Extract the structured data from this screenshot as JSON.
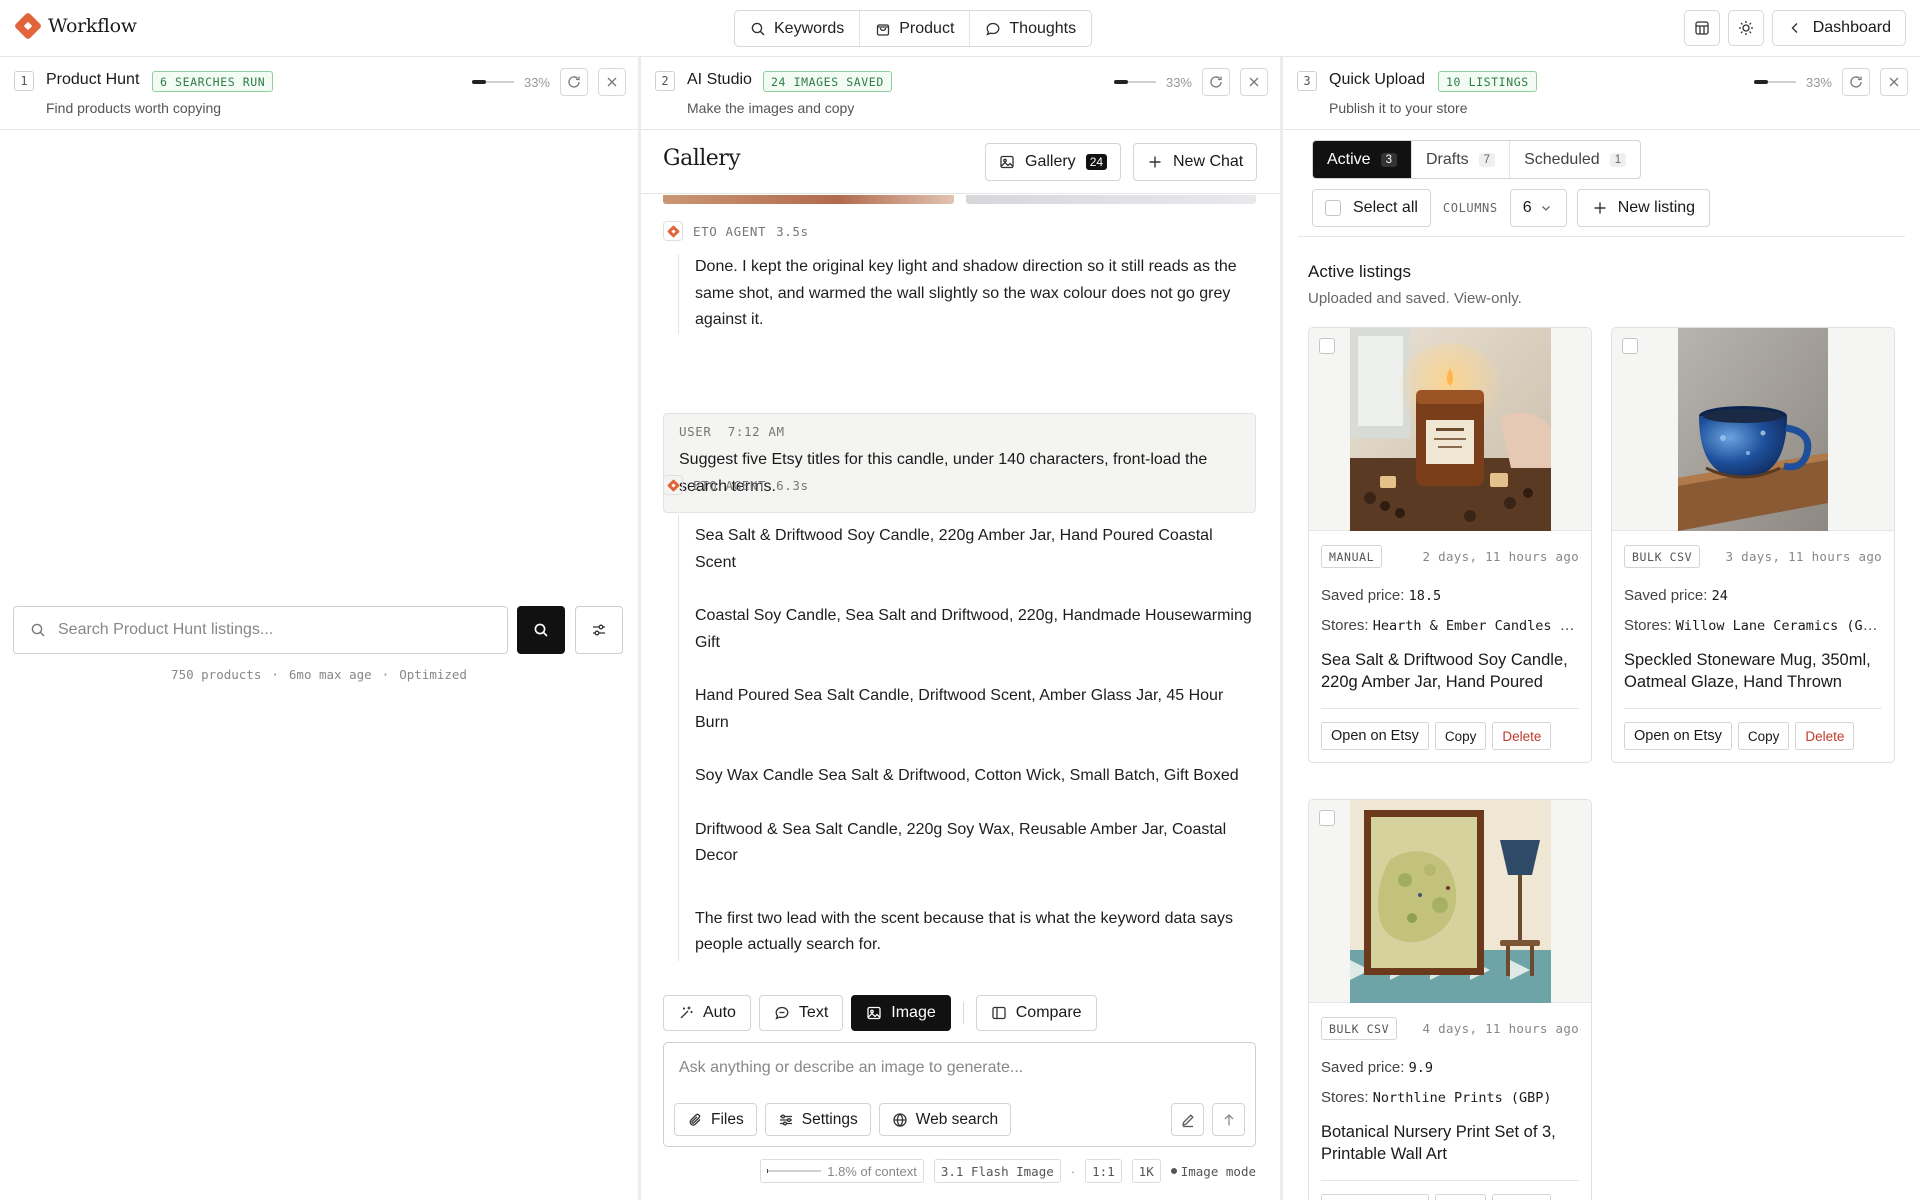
{
  "app": {
    "name": "Workflow"
  },
  "nav": {
    "keywords": "Keywords",
    "product": "Product",
    "thoughts": "Thoughts",
    "dashboard": "Dashboard"
  },
  "col1": {
    "index": "1",
    "title": "Product Hunt",
    "badge": "6 SEARCHES RUN",
    "subtitle": "Find products worth copying",
    "zoom": "33%",
    "search_placeholder": "Search Product Hunt listings...",
    "meta": [
      "750 products",
      "6mo max age",
      "Optimized"
    ]
  },
  "col2": {
    "index": "2",
    "title": "AI Studio",
    "badge": "24 IMAGES SAVED",
    "subtitle": "Make the images and copy",
    "zoom": "33%",
    "gallery_title": "Gallery",
    "gallery_btn": "Gallery",
    "gallery_count": "24",
    "new_chat": "New Chat",
    "messages": [
      {
        "role": "ETO AGENT",
        "time": "3.5s",
        "text": "Done. I kept the original key light and shadow direction so it still reads as the same shot, and warmed the wall slightly so the wax colour does not go grey against it."
      },
      {
        "role": "USER",
        "time": "7:12 AM",
        "text": "Suggest five Etsy titles for this candle, under 140 characters, front-load the search terms."
      },
      {
        "role": "ETO AGENT",
        "time": "6.3s",
        "titles": [
          "Sea Salt & Driftwood Soy Candle, 220g Amber Jar, Hand Poured Coastal Scent",
          "Coastal Soy Candle, Sea Salt and Driftwood, 220g, Handmade Housewarming Gift",
          "Hand Poured Sea Salt Candle, Driftwood Scent, Amber Glass Jar, 45 Hour Burn",
          "Soy Wax Candle Sea Salt & Driftwood, Cotton Wick, Small Batch, Gift Boxed",
          "Driftwood & Sea Salt Candle, 220g Soy Wax, Reusable Amber Jar, Coastal Decor"
        ],
        "text": "The first two lead with the scent because that is what the keyword data says people actually search for."
      }
    ],
    "modes": {
      "auto": "Auto",
      "text": "Text",
      "image": "Image",
      "compare": "Compare"
    },
    "composer_placeholder": "Ask anything or describe an image to generate...",
    "tools": {
      "files": "Files",
      "settings": "Settings",
      "web": "Web search"
    },
    "status": {
      "context": "1.8% of context",
      "context_pct": 1.8,
      "model": "3.1 Flash Image",
      "ratio": "1:1",
      "size": "1K",
      "mode": "Image mode"
    }
  },
  "col3": {
    "index": "3",
    "title": "Quick Upload",
    "badge": "10 LISTINGS",
    "subtitle": "Publish it to your store",
    "zoom": "33%",
    "tabs": [
      {
        "label": "Active",
        "count": "3"
      },
      {
        "label": "Drafts",
        "count": "7"
      },
      {
        "label": "Scheduled",
        "count": "1"
      }
    ],
    "select_all": "Select all",
    "columns_label": "COLUMNS",
    "columns_value": "6",
    "new_listing": "New listing",
    "section_title": "Active listings",
    "section_sub": "Uploaded and saved. View-only.",
    "price_label": "Saved price:",
    "stores_label": "Stores:",
    "actions": {
      "open": "Open on Etsy",
      "copy": "Copy",
      "delete": "Delete"
    },
    "listings": [
      {
        "source": "MANUAL",
        "time": "2 days, 11 hours ago",
        "price": "18.5",
        "stores": "Hearth & Ember Candles (GBP)",
        "title": "Sea Salt & Driftwood Soy Candle, 220g Amber Jar, Hand Poured"
      },
      {
        "source": "BULK CSV",
        "time": "3 days, 11 hours ago",
        "price": "24",
        "stores": "Willow Lane Ceramics (GBP)",
        "title": "Speckled Stoneware Mug, 350ml, Oatmeal Glaze, Hand Thrown"
      },
      {
        "source": "BULK CSV",
        "time": "4 days, 11 hours ago",
        "price": "9.9",
        "stores": "Northline Prints (GBP)",
        "title": "Botanical Nursery Print Set of 3, Printable Wall Art"
      }
    ]
  },
  "colors": {
    "accent": "#e2643a",
    "badge_green": "#2f7d45",
    "delete_red": "#c0392b"
  }
}
